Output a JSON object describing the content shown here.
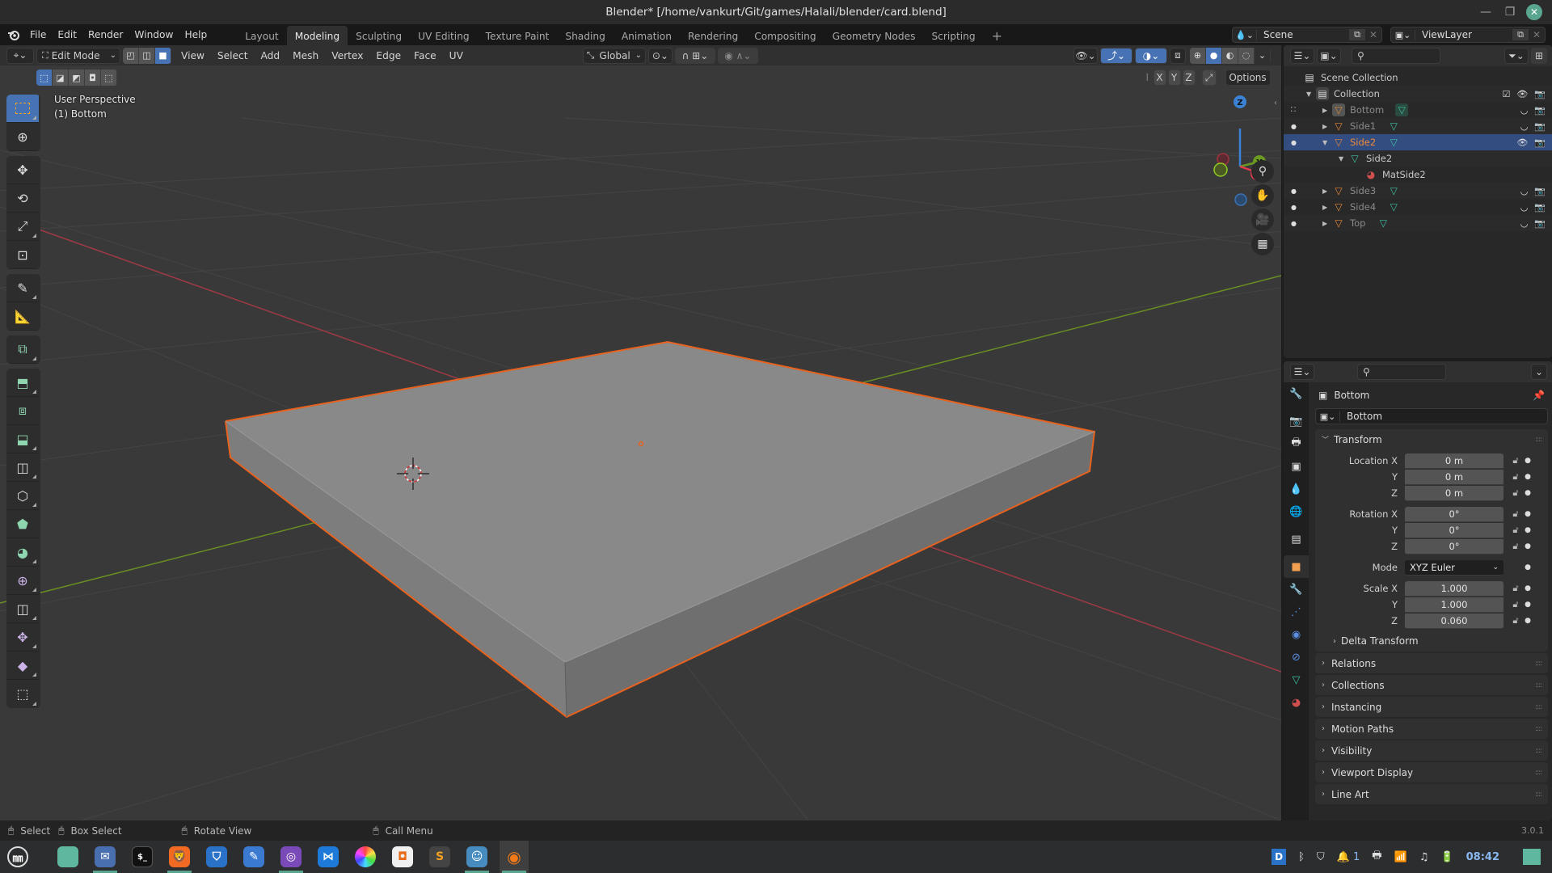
{
  "window": {
    "title": "Blender* [/home/vankurt/Git/games/Halali/blender/card.blend]"
  },
  "menu": {
    "items": [
      "File",
      "Edit",
      "Render",
      "Window",
      "Help"
    ]
  },
  "workspaces": {
    "tabs": [
      "Layout",
      "Modeling",
      "Sculpting",
      "UV Editing",
      "Texture Paint",
      "Shading",
      "Animation",
      "Rendering",
      "Compositing",
      "Geometry Nodes",
      "Scripting"
    ],
    "active": "Modeling",
    "add_label": "+"
  },
  "scene": {
    "name": "Scene",
    "view_layer": "ViewLayer"
  },
  "viewport_header": {
    "mode": "Edit Mode",
    "menus": [
      "View",
      "Select",
      "Add",
      "Mesh",
      "Vertex",
      "Edge",
      "Face",
      "UV"
    ],
    "orientation": "Global",
    "options_label": "Options",
    "mirror_axes": [
      "X",
      "Y",
      "Z"
    ]
  },
  "viewport": {
    "view_name": "User Perspective",
    "object_info": "(1) Bottom",
    "gizmo_axes": {
      "x": "X",
      "y": "Y",
      "z": "Z"
    },
    "colors": {
      "selection_outline": "#e8621e",
      "x_axis": "#a0323e",
      "y_axis": "#6a8e22",
      "grid_bg": "#393939"
    }
  },
  "toolbar": {
    "tools": [
      {
        "name": "select-box",
        "active": true
      },
      {
        "name": "cursor"
      },
      {
        "name": "move"
      },
      {
        "name": "rotate"
      },
      {
        "name": "scale"
      },
      {
        "name": "transform"
      },
      {
        "name": "annotate"
      },
      {
        "name": "measure"
      },
      {
        "name": "add-cube"
      },
      {
        "name": "extrude-region"
      },
      {
        "name": "inset-faces"
      },
      {
        "name": "bevel"
      },
      {
        "name": "loop-cut"
      },
      {
        "name": "knife"
      },
      {
        "name": "poly-build"
      },
      {
        "name": "spin"
      },
      {
        "name": "smooth"
      },
      {
        "name": "edge-slide"
      },
      {
        "name": "shrink-fatten"
      },
      {
        "name": "shear"
      },
      {
        "name": "rip-region"
      }
    ]
  },
  "outliner": {
    "root": "Scene Collection",
    "collection": "Collection",
    "rows": [
      {
        "name": "Bottom",
        "level": 1,
        "type": "object",
        "expanded": false,
        "active": true
      },
      {
        "name": "Side1",
        "level": 1,
        "type": "object",
        "expanded": false
      },
      {
        "name": "Side2",
        "level": 1,
        "type": "object",
        "expanded": true,
        "selected": true
      },
      {
        "name": "Side2",
        "level": 2,
        "type": "mesh",
        "expanded": true
      },
      {
        "name": "MatSide2",
        "level": 3,
        "type": "material"
      },
      {
        "name": "Side3",
        "level": 1,
        "type": "object",
        "expanded": false
      },
      {
        "name": "Side4",
        "level": 1,
        "type": "object",
        "expanded": false
      },
      {
        "name": "Top",
        "level": 1,
        "type": "object",
        "expanded": false
      }
    ]
  },
  "properties": {
    "context_name": "Bottom",
    "object_name": "Bottom",
    "transform": {
      "title": "Transform",
      "location_label": "Location X",
      "location": [
        "0 m",
        "0 m",
        "0 m"
      ],
      "rotation_label": "Rotation X",
      "rotation": [
        "0°",
        "0°",
        "0°"
      ],
      "mode_label": "Mode",
      "mode": "XYZ Euler",
      "scale_label": "Scale X",
      "scale": [
        "1.000",
        "1.000",
        "0.060"
      ],
      "axis_labels": [
        "Y",
        "Z"
      ],
      "delta_transform": "Delta Transform"
    },
    "panels": [
      "Relations",
      "Collections",
      "Instancing",
      "Motion Paths",
      "Visibility",
      "Viewport Display",
      "Line Art"
    ]
  },
  "statusbar": {
    "select": "Select",
    "box_select": "Box Select",
    "rotate_view": "Rotate View",
    "call_menu": "Call Menu",
    "version": "3.0.1"
  },
  "taskbar": {
    "apps": [
      "menu",
      "files",
      "mail",
      "terminal",
      "brave",
      "bitwarden",
      "notes",
      "github-desktop",
      "vscode",
      "color-picker",
      "virtualbox",
      "sublime-text",
      "godot",
      "blender"
    ],
    "notifications_count": "1",
    "clock": "08:42"
  }
}
